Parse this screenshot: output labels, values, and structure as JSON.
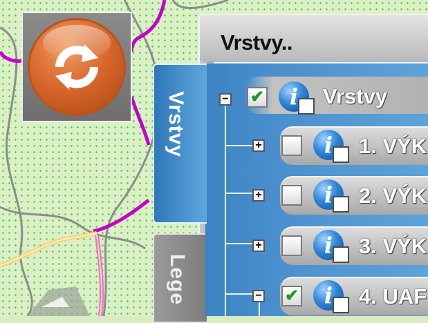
{
  "refresh": {
    "icon": "refresh-icon",
    "accent": "#d8682c"
  },
  "panel": {
    "title": "Vrstvy.."
  },
  "tabs": {
    "layers": "Vrstvy",
    "legend": "Lege"
  },
  "tree": {
    "root": {
      "label": "Vrstvy",
      "expander": "−",
      "checked": true,
      "check_mark": "✔"
    },
    "items": [
      {
        "label": "1. VÝK",
        "expander": "+",
        "checked": false,
        "check_mark": ""
      },
      {
        "label": "2. VÝK",
        "expander": "+",
        "checked": false,
        "check_mark": ""
      },
      {
        "label": "3. VÝK",
        "expander": "+",
        "checked": false,
        "check_mark": ""
      },
      {
        "label": "4. UAF",
        "expander": "−",
        "checked": true,
        "check_mark": "✔"
      }
    ]
  },
  "colors": {
    "panel_blue": "#3c83c3",
    "check_green": "#1f9a1f"
  }
}
